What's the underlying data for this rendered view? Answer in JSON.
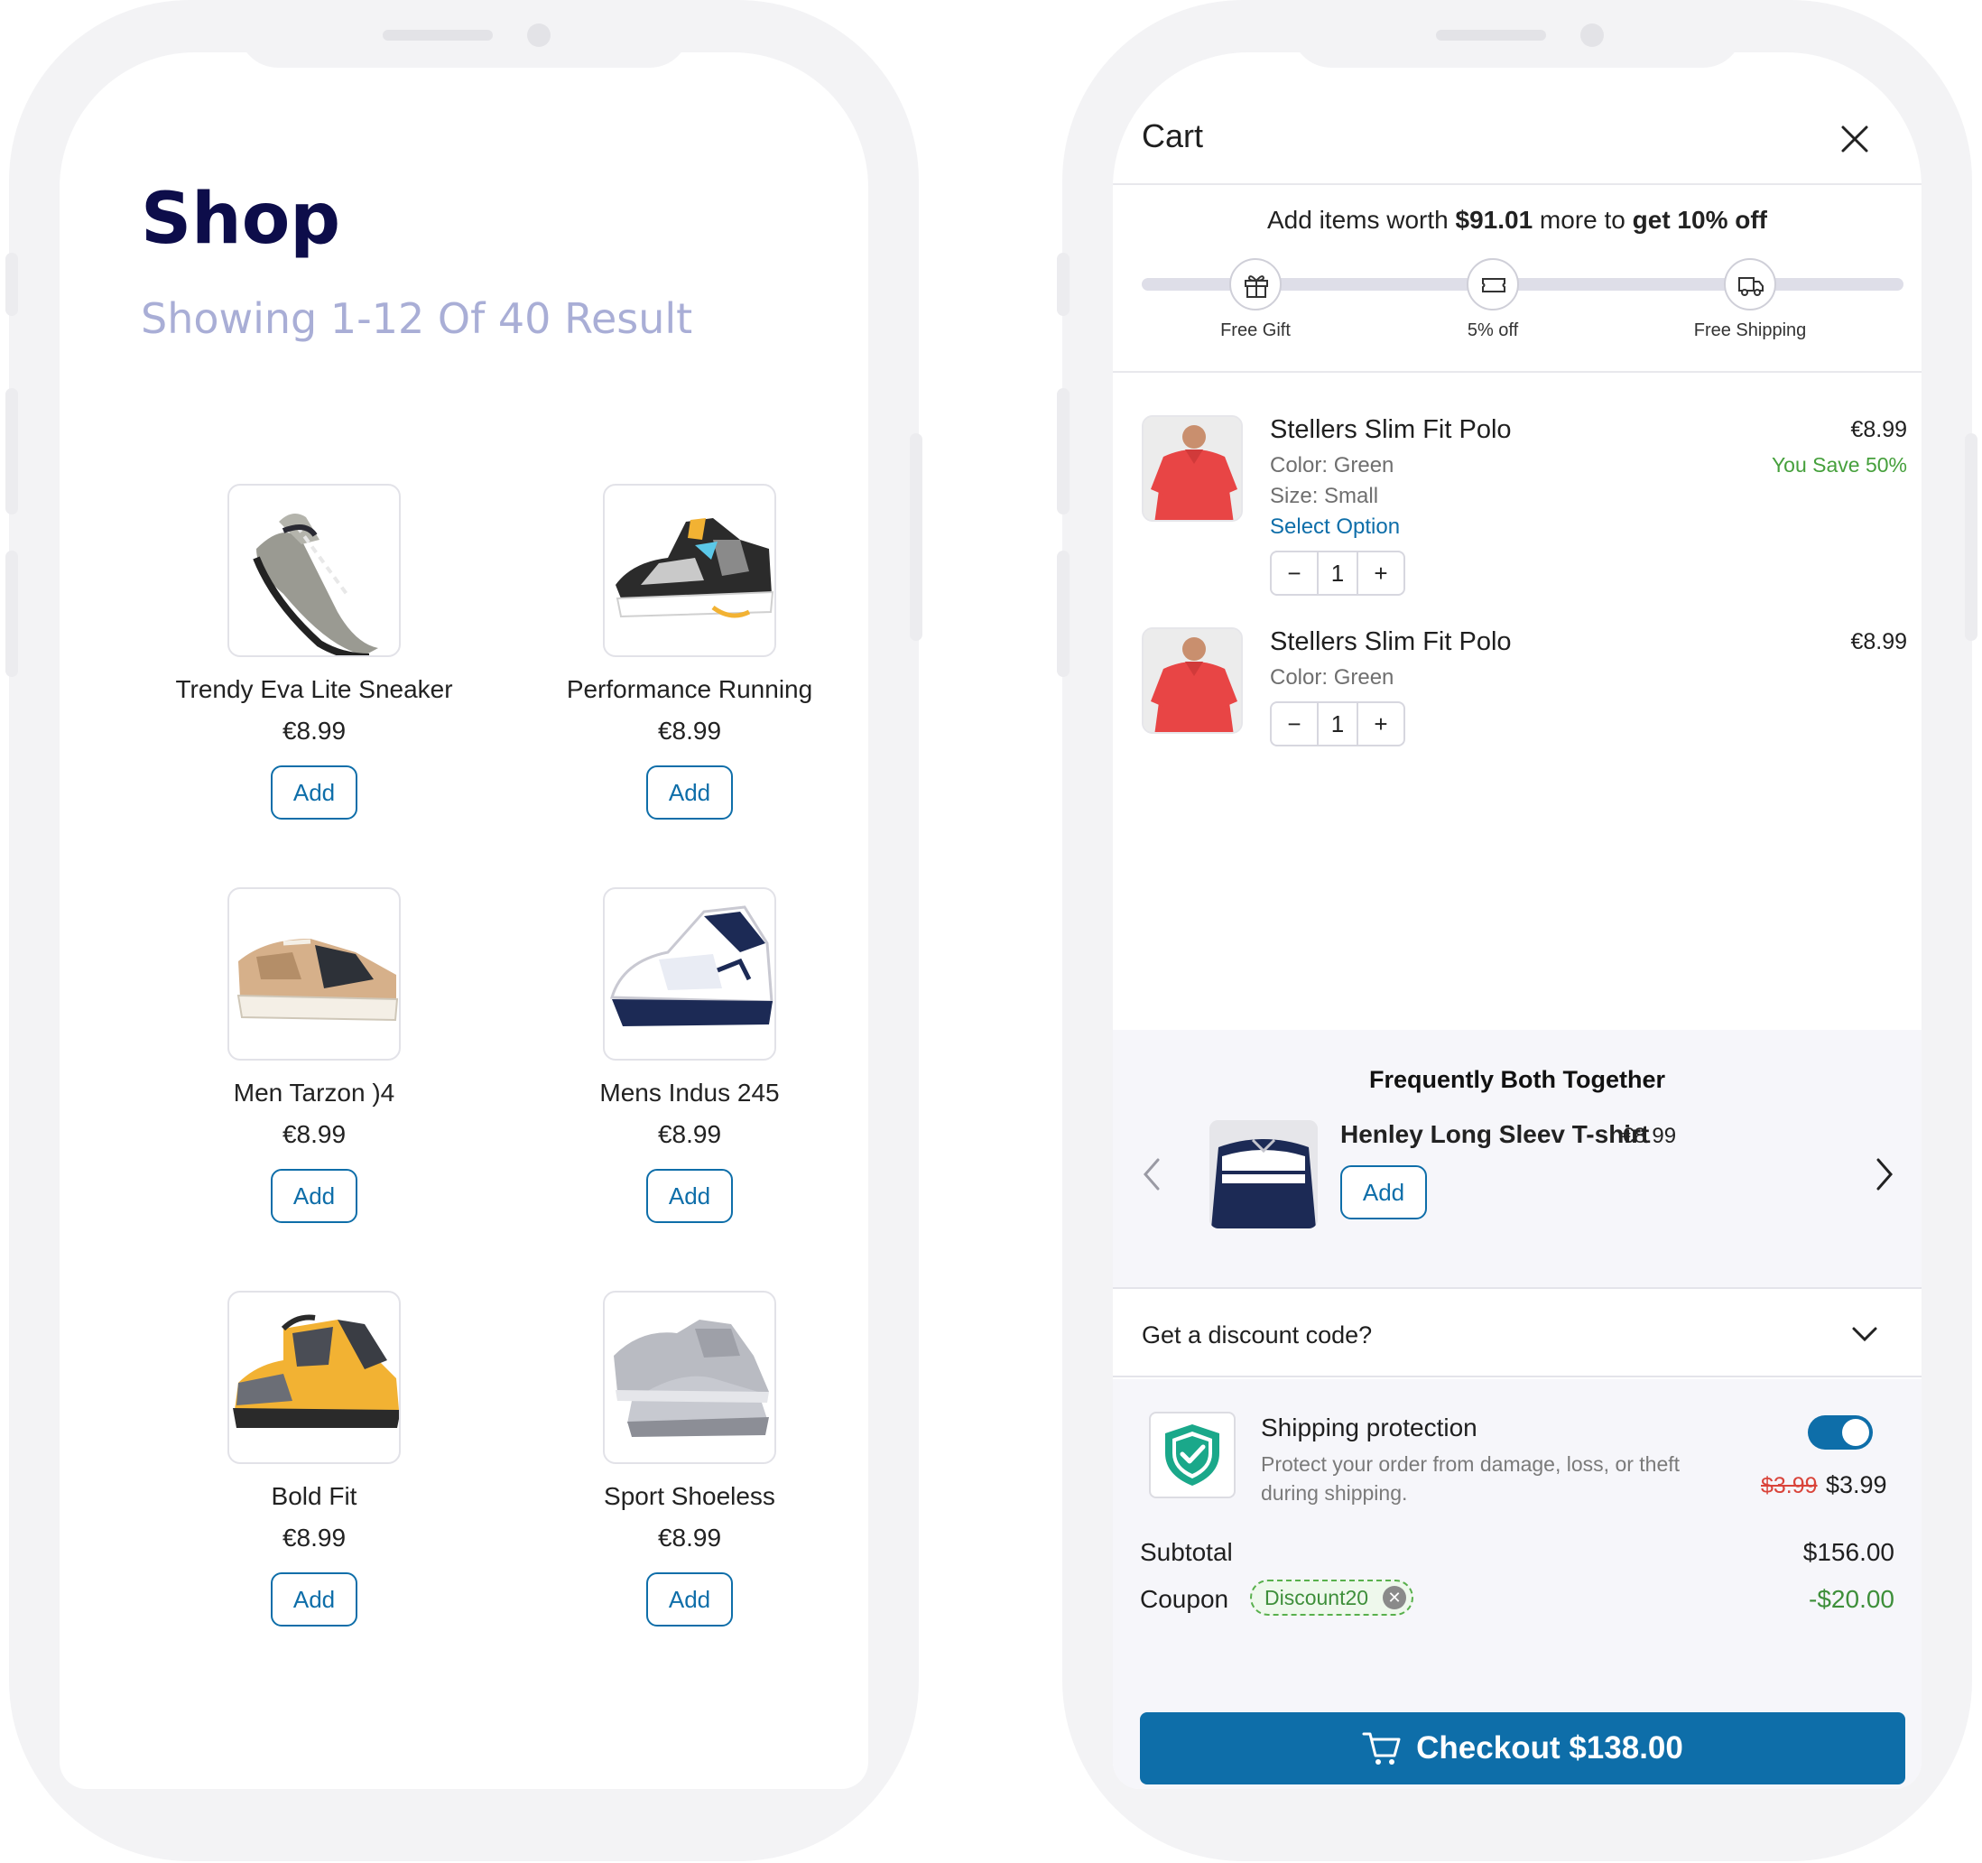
{
  "shop": {
    "title": "Shop",
    "subtitle": "Showing 1-12 Of 40 Result",
    "add_label": "Add",
    "products": [
      {
        "name": "Trendy Eva Lite Sneaker",
        "price": "€8.99"
      },
      {
        "name": "Performance Running",
        "price": "€8.99"
      },
      {
        "name": "Men Tarzon )4",
        "price": "€8.99"
      },
      {
        "name": "Mens Indus 245",
        "price": "€8.99"
      },
      {
        "name": "Bold Fit",
        "price": "€8.99"
      },
      {
        "name": "Sport Shoeless",
        "price": "€8.99"
      }
    ]
  },
  "cart": {
    "title": "Cart",
    "close_icon": "close-icon",
    "reward": {
      "prefix": "Add items worth ",
      "amount": "$91.01",
      "middle": " more to ",
      "goal": "get 10% off",
      "milestones": [
        {
          "label": "Free Gift",
          "icon": "gift-icon"
        },
        {
          "label": "5% off",
          "icon": "ticket-icon"
        },
        {
          "label": "Free Shipping",
          "icon": "truck-icon"
        }
      ]
    },
    "items": [
      {
        "name": "Stellers Slim Fit Polo",
        "price": "€8.99",
        "save": "You Save 50%",
        "color": "Color: Green",
        "size": "Size: Small",
        "select_option": "Select Option",
        "qty": "1"
      },
      {
        "name": "Stellers Slim Fit Polo",
        "price": "€8.99",
        "color": "Color: Green",
        "qty": "1"
      }
    ],
    "stepper": {
      "minus": "−",
      "plus": "+"
    },
    "fbt": {
      "title": "Frequently Both Together",
      "product": {
        "name": "Henley Long Sleev T-shirt",
        "price": "€8.99"
      },
      "add_label": "Add"
    },
    "discount": {
      "label": "Get a discount code?"
    },
    "shipping_protection": {
      "title": "Shipping protection",
      "description": "Protect your order from damage, loss, or theft during shipping.",
      "old_price": "$3.99",
      "price": "$3.99",
      "enabled": true
    },
    "summary": {
      "subtotal_label": "Subtotal",
      "subtotal": "$156.00",
      "coupon_label": "Coupon",
      "coupon_code": "Discount20",
      "coupon_value": "-$20.00"
    },
    "checkout_label": "Checkout $138.00"
  },
  "colors": {
    "brand_blue": "#0e6ea9",
    "shop_title": "#0d0d4a",
    "subtitle": "#a9aed6",
    "savings_green": "#46a03c",
    "strike_red": "#d9443a",
    "shield_teal": "#1aa88a"
  }
}
